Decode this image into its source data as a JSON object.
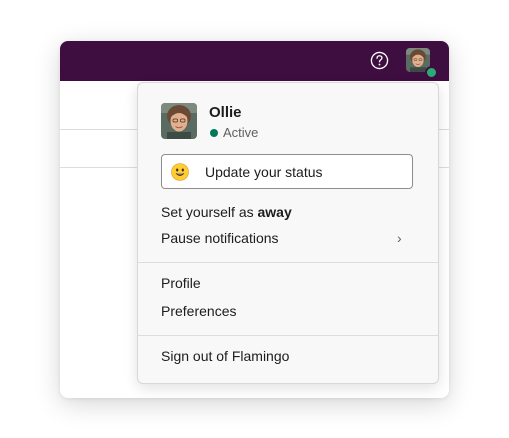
{
  "user": {
    "name": "Ollie",
    "status": "Active"
  },
  "status_button": {
    "label": "Update your status",
    "emoji_icon": "smiling-face-emoji"
  },
  "menu": {
    "away_prefix": "Set yourself as ",
    "away_bold": "away",
    "pause_label": "Pause notifications",
    "pause_chevron": "›",
    "profile_label": "Profile",
    "preferences_label": "Preferences",
    "sign_out_label": "Sign out of Flamingo"
  },
  "colors": {
    "topbar": "#3f0e40",
    "presence_active": "#2bac76",
    "status_dot": "#007a5a"
  }
}
